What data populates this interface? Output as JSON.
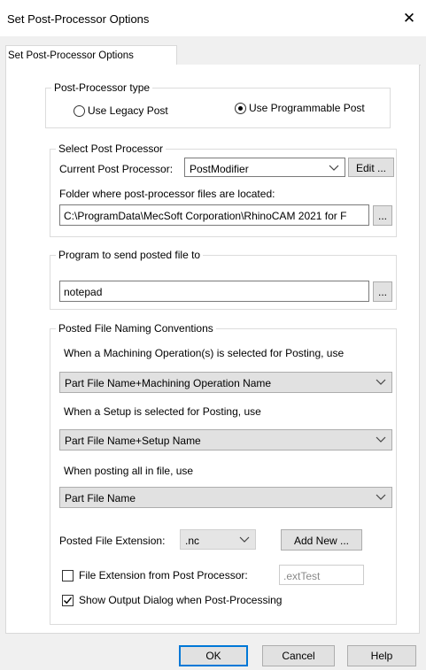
{
  "window": {
    "title": "Set Post-Processor Options",
    "close_glyph": "✕"
  },
  "tab": {
    "label": "Set Post-Processor Options"
  },
  "post_type": {
    "legend": "Post-Processor type",
    "legacy_label": "Use Legacy Post",
    "programmable_label": "Use Programmable Post",
    "selected": "programmable"
  },
  "select_post": {
    "legend": "Select Post Processor",
    "current_label": "Current Post Processor:",
    "current_value": "PostModifier",
    "edit_button": "Edit ...",
    "folder_label": "Folder where post-processor files are located:",
    "folder_value": "C:\\ProgramData\\MecSoft Corporation\\RhinoCAM 2021 for F",
    "browse_button": "..."
  },
  "send_program": {
    "legend": "Program to send posted file to",
    "value": "notepad",
    "browse_button": "..."
  },
  "naming": {
    "legend": "Posted File Naming Conventions",
    "op_label": "When a Machining Operation(s) is selected for Posting, use",
    "op_value": "Part File Name+Machining Operation Name",
    "setup_label": "When a Setup is selected for Posting, use",
    "setup_value": "Part File Name+Setup Name",
    "all_label": "When posting all in file, use",
    "all_value": "Part File Name",
    "ext_label": "Posted File Extension:",
    "ext_value": ".nc",
    "add_new_button": "Add New ...",
    "ext_from_post_label": "File Extension from Post Processor:",
    "ext_from_post_checked": false,
    "ext_from_post_value": ".extTest",
    "show_output_label": "Show Output Dialog when Post-Processing",
    "show_output_checked": true
  },
  "footer": {
    "ok": "OK",
    "cancel": "Cancel",
    "help": "Help"
  }
}
